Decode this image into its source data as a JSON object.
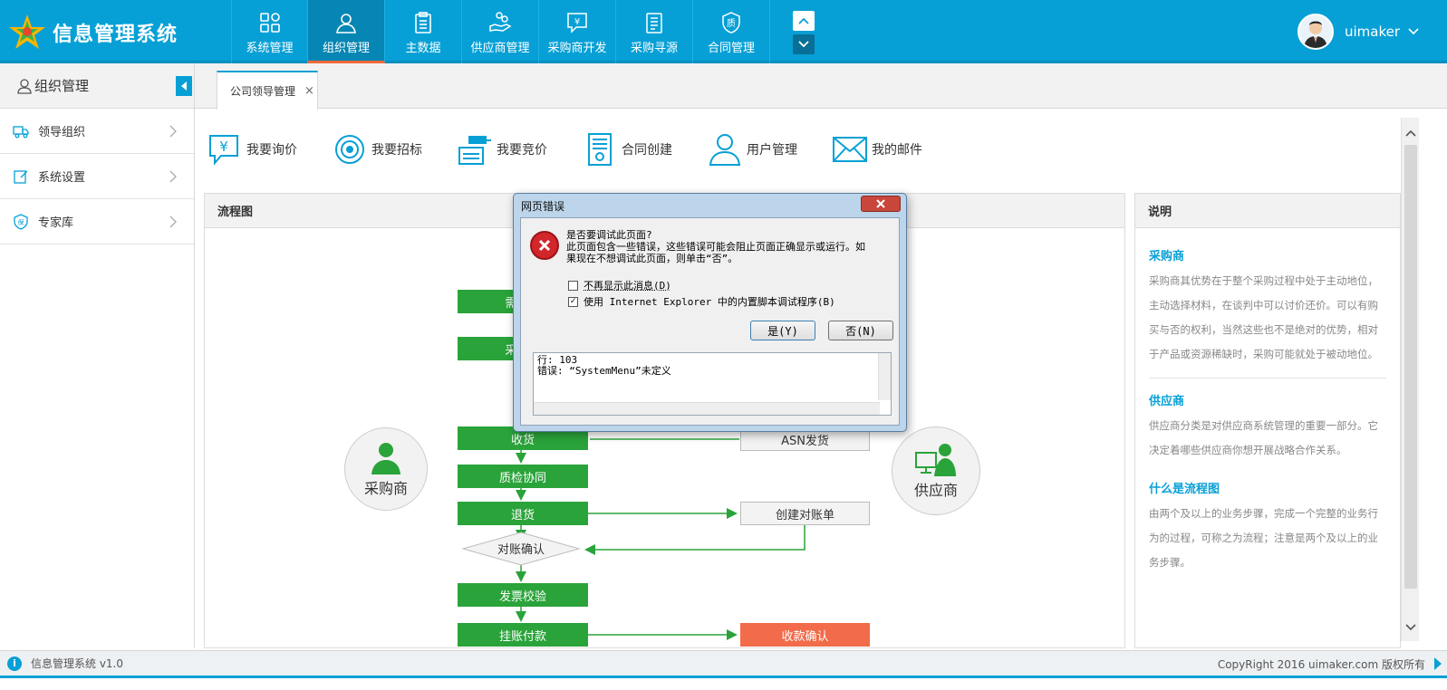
{
  "app": {
    "title": "信息管理系统",
    "colors": {
      "primary": "#07a0d6",
      "green": "#2aa33a",
      "red": "#f26b4a",
      "active_underline": "#f26b3a"
    }
  },
  "nav": {
    "items": [
      {
        "label": "系统管理",
        "icon": "grid-icon"
      },
      {
        "label": "组织管理",
        "icon": "user-icon",
        "active": true
      },
      {
        "label": "主数据",
        "icon": "clipboard-icon"
      },
      {
        "label": "供应商管理",
        "icon": "hand-coins-icon"
      },
      {
        "label": "采购商开发",
        "icon": "yen-chat-icon"
      },
      {
        "label": "采购寻源",
        "icon": "document-list-icon"
      },
      {
        "label": "合同管理",
        "icon": "contract-seal-icon"
      }
    ]
  },
  "user": {
    "name": "uimaker"
  },
  "sidebar": {
    "title": "组织管理",
    "items": [
      {
        "label": "领导组织",
        "icon": "truck-icon"
      },
      {
        "label": "系统设置",
        "icon": "edit-icon"
      },
      {
        "label": "专家库",
        "icon": "shield-icon"
      }
    ]
  },
  "tabs": [
    {
      "label": "公司领导管理",
      "close": "×"
    }
  ],
  "quick_actions": [
    {
      "label": "我要询价",
      "icon": "yen-chat-icon"
    },
    {
      "label": "我要招标",
      "icon": "target-icon"
    },
    {
      "label": "我要竞价",
      "icon": "gavel-icon"
    },
    {
      "label": "合同创建",
      "icon": "contract-icon"
    },
    {
      "label": "用户管理",
      "icon": "user-outline-icon"
    },
    {
      "label": "我的邮件",
      "icon": "mail-icon"
    }
  ],
  "flow": {
    "title": "流程图",
    "left_role": "采购商",
    "right_role": "供应商",
    "steps": {
      "s1": "需求计",
      "s2": "采购计",
      "receive": "收货",
      "qc": "质检协同",
      "return": "退货",
      "reconcile": "对账确认",
      "invoice": "发票校验",
      "pay": "挂账付款",
      "asn": "ASN发货",
      "create_statement": "创建对账单",
      "confirm_receipt": "收款确认"
    }
  },
  "notes": {
    "title": "说明",
    "sections": [
      {
        "heading": "采购商",
        "text": "采购商其优势在于整个采购过程中处于主动地位，主动选择材料，在谈判中可以讨价还价。可以有购买与否的权利，当然这些也不是绝对的优势，相对于产品或资源稀缺时，采购可能就处于被动地位。"
      },
      {
        "heading": "供应商",
        "text": "供应商分类是对供应商系统管理的重要一部分。它决定着哪些供应商你想开展战略合作关系。"
      },
      {
        "heading": "什么是流程图",
        "text": "由两个及以上的业务步骤，完成一个完整的业务行为的过程，可称之为流程；注意是两个及以上的业务步骤。"
      }
    ]
  },
  "dialog": {
    "title": "网页错误",
    "message_1": "是否要调试此页面?",
    "message_2": "此页面包含一些错误，这些错误可能会阻止页面正确显示或运行。如",
    "message_3": "果现在不想调试此页面，则单击“否”。",
    "check_1": "不再显示此消息(D)",
    "check_2": "使用 Internet Explorer 中的内置脚本调试程序(B)",
    "check_1_checked": false,
    "check_2_checked": true,
    "yes": "是(Y)",
    "no": "否(N)",
    "log_line_1": "行: 103",
    "log_line_2": "错误: “SystemMenu”未定义"
  },
  "footer": {
    "left": "信息管理系统 v1.0",
    "right": "CopyRight 2016  uimaker.com 版权所有"
  }
}
